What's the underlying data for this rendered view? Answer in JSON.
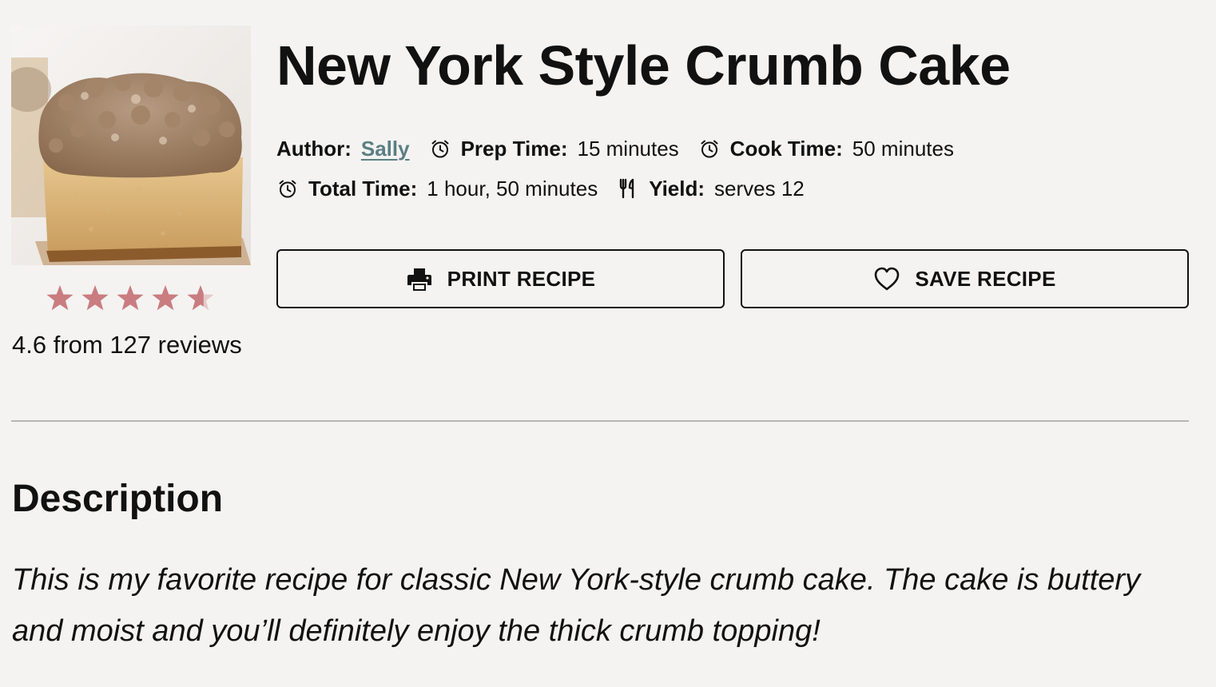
{
  "recipe": {
    "title": "New York Style Crumb Cake",
    "image_alt": "crumb cake square",
    "rating": {
      "value": 4.6,
      "max": 5,
      "stars_filled": 4.6,
      "text": "4.6 from 127 reviews",
      "star_color": "#c97d80"
    },
    "meta": {
      "author_label": "Author:",
      "author_value": "Sally",
      "prep_label": "Prep Time:",
      "prep_value": "15 minutes",
      "cook_label": "Cook Time:",
      "cook_value": "50 minutes",
      "total_label": "Total Time:",
      "total_value": "1 hour, 50 minutes",
      "yield_label": "Yield:",
      "yield_value": "serves 12"
    },
    "buttons": {
      "print_label": "PRINT RECIPE",
      "save_label": "SAVE RECIPE"
    },
    "description": {
      "heading": "Description",
      "text": "This is my favorite recipe for classic New York-style crumb cake. The cake is buttery and moist and you’ll definitely enjoy the thick crumb topping!"
    }
  },
  "icons": {
    "clock": "alarm-clock-icon",
    "yield": "fork-knife-icon",
    "print": "printer-icon",
    "save": "heart-icon",
    "star": "star-icon"
  },
  "colors": {
    "background": "#f4f3f2",
    "link": "#5b7f82",
    "text": "#111111"
  }
}
